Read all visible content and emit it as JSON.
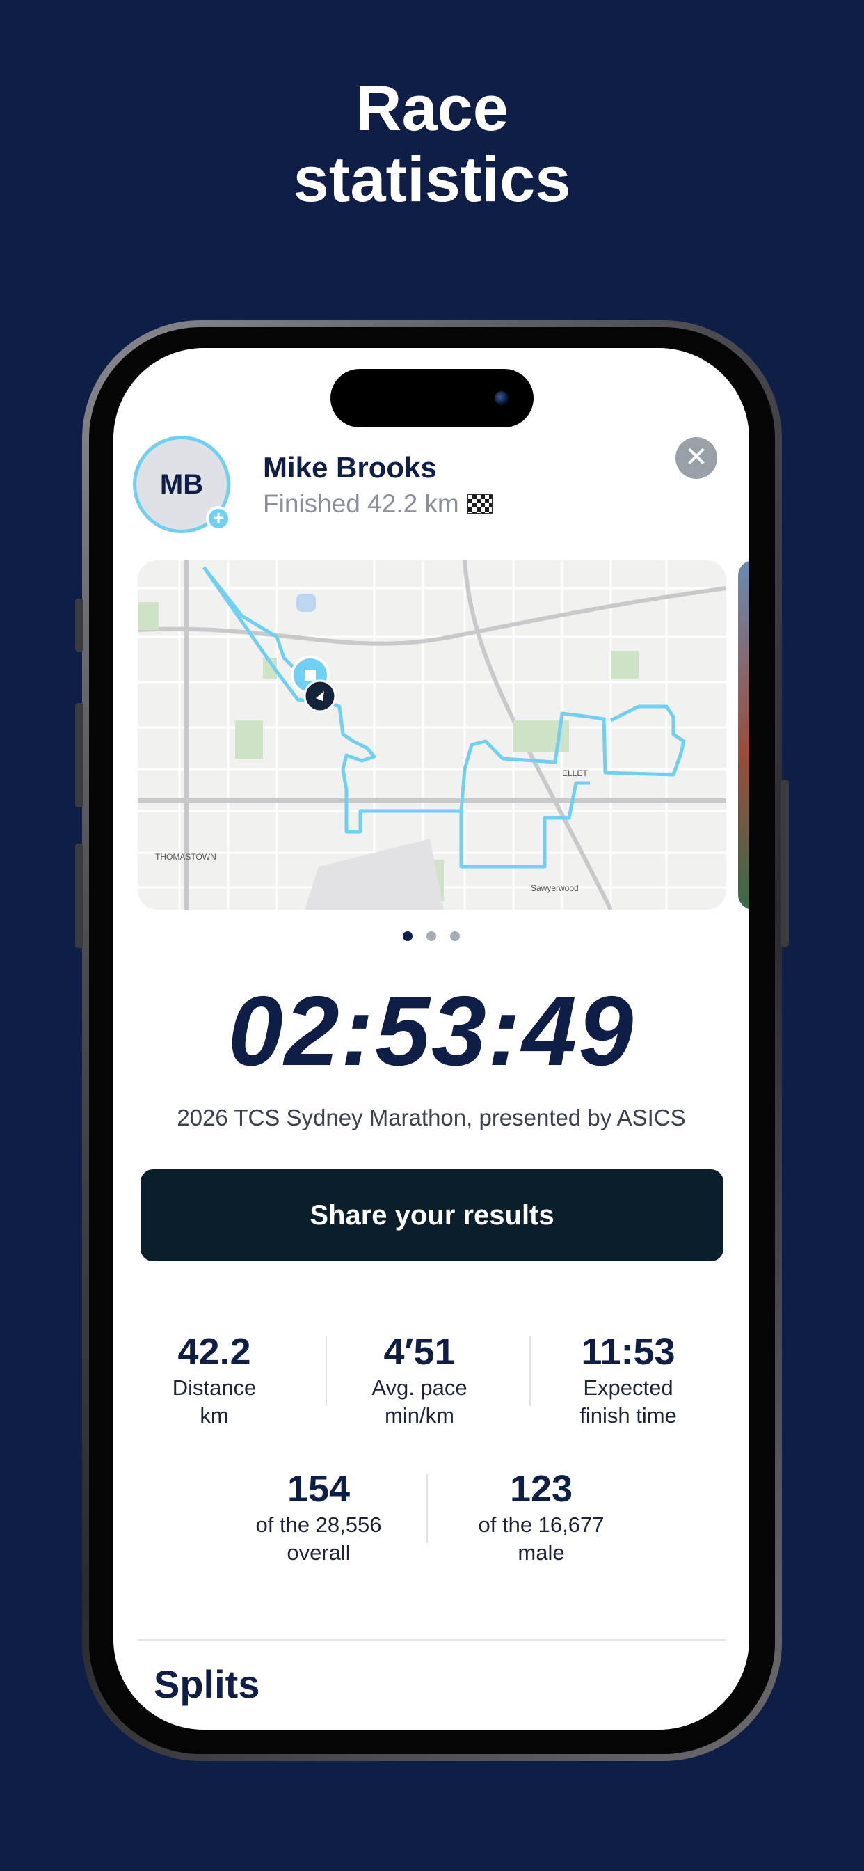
{
  "headline": {
    "line1": "Race",
    "line2": "statistics"
  },
  "profile": {
    "initials": "MB",
    "name": "Mike Brooks",
    "status": "Finished 42.2 km",
    "status_icon": "checkered-flag-icon"
  },
  "map": {
    "labels": [
      "THOMASTOWN",
      "ELLET",
      "Sawyerwood"
    ],
    "route_color": "#6fd0f2"
  },
  "carousel": {
    "pages": 3,
    "active_index": 0
  },
  "race": {
    "time": "02:53:49",
    "name": "2026 TCS Sydney Marathon, presented by ASICS"
  },
  "share_button": {
    "label": "Share your results"
  },
  "stats_row1": [
    {
      "value": "42.2",
      "label_line1": "Distance",
      "label_line2": "km"
    },
    {
      "value": "4′51",
      "label_line1": "Avg. pace",
      "label_line2": "min/km"
    },
    {
      "value": "11:53",
      "label_line1": "Expected",
      "label_line2": "finish time"
    }
  ],
  "stats_row2": [
    {
      "value": "154",
      "label_line1": "of the 28,556",
      "label_line2": "overall"
    },
    {
      "value": "123",
      "label_line1": "of the 16,677",
      "label_line2": "male"
    }
  ],
  "splits": {
    "title": "Splits"
  },
  "colors": {
    "background": "#0f1e46",
    "accent": "#6fd0f2",
    "button": "#0b1e2c"
  }
}
